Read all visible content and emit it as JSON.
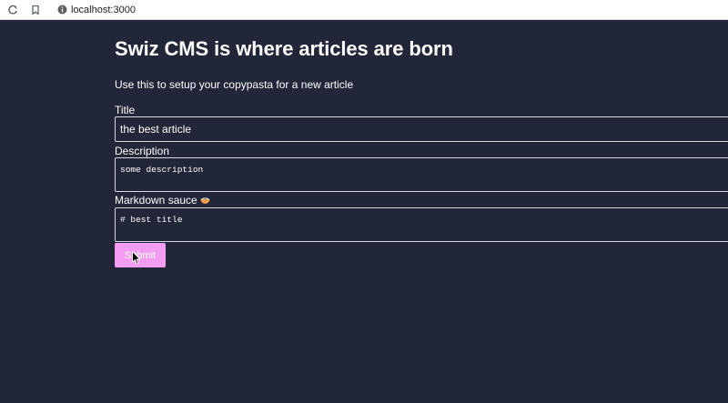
{
  "browser": {
    "url": "localhost:3000",
    "reload_icon": "reload-icon",
    "bookmark_icon": "bookmark-icon",
    "site_info_icon": "info-icon"
  },
  "page": {
    "title": "Swiz CMS is where articles are born",
    "intro": "Use this to setup your copypasta for a new article"
  },
  "form": {
    "title_label": "Title",
    "title_value": "the best article",
    "description_label": "Description",
    "description_value": "some description",
    "markdown_label": "Markdown sauce",
    "markdown_icon": "bowl-icon",
    "markdown_value": "# best title",
    "submit_label": "Submit"
  },
  "colors": {
    "background": "#222639",
    "text": "#ffffff",
    "field_border": "#d7d7e0",
    "submit_background": "#f49cf1"
  }
}
